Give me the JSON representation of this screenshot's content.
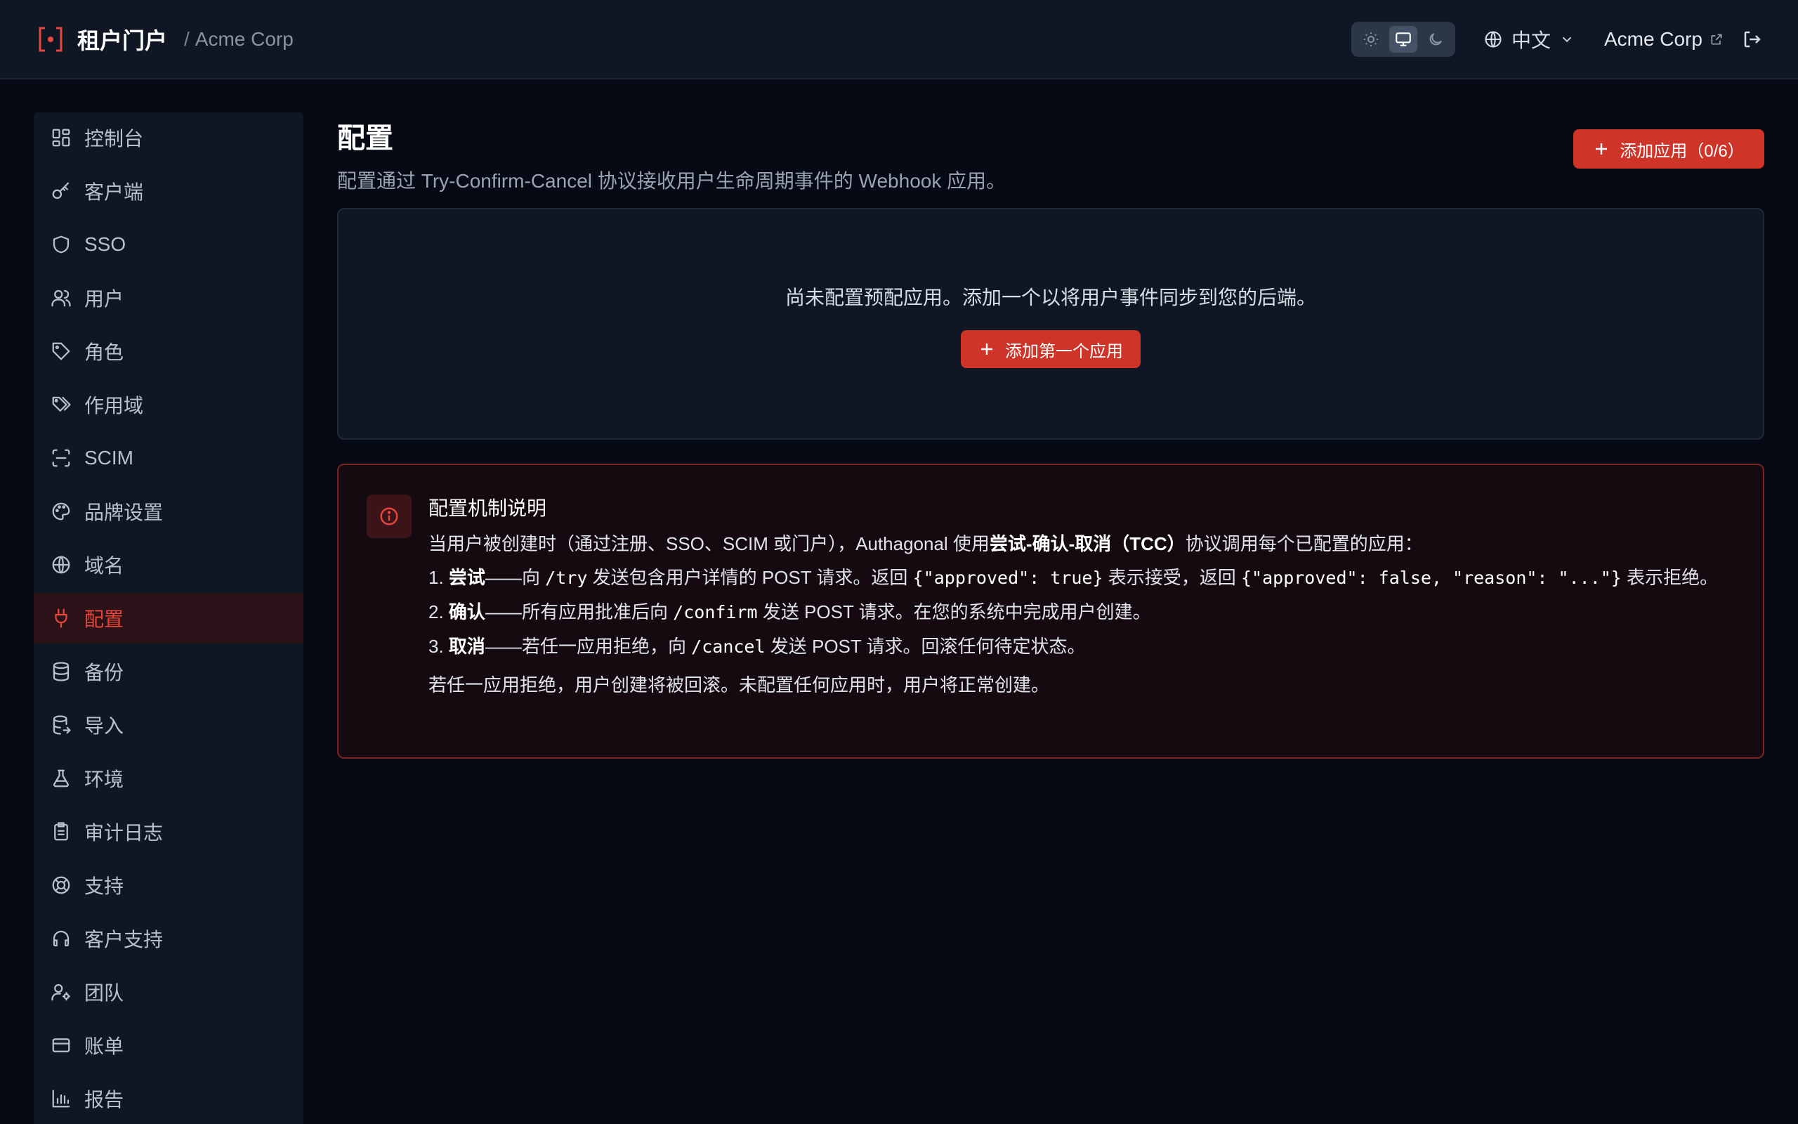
{
  "header": {
    "app_title": "租户门户",
    "separator": "/",
    "org_crumb": "Acme Corp",
    "language": "中文",
    "org_link": "Acme Corp"
  },
  "sidebar": {
    "items": [
      {
        "label": "控制台",
        "icon": "dashboard-icon"
      },
      {
        "label": "客户端",
        "icon": "key-icon"
      },
      {
        "label": "SSO",
        "icon": "shield-icon"
      },
      {
        "label": "用户",
        "icon": "users-icon"
      },
      {
        "label": "角色",
        "icon": "tag-icon"
      },
      {
        "label": "作用域",
        "icon": "tags-icon"
      },
      {
        "label": "SCIM",
        "icon": "scan-icon"
      },
      {
        "label": "品牌设置",
        "icon": "palette-icon"
      },
      {
        "label": "域名",
        "icon": "globe-icon"
      },
      {
        "label": "配置",
        "icon": "plug-icon",
        "active": true
      },
      {
        "label": "备份",
        "icon": "database-icon"
      },
      {
        "label": "导入",
        "icon": "database-import-icon"
      },
      {
        "label": "环境",
        "icon": "flask-icon"
      },
      {
        "label": "审计日志",
        "icon": "clipboard-icon"
      },
      {
        "label": "支持",
        "icon": "lifebuoy-icon"
      },
      {
        "label": "客户支持",
        "icon": "headset-icon"
      },
      {
        "label": "团队",
        "icon": "user-gear-icon"
      },
      {
        "label": "账单",
        "icon": "credit-card-icon"
      },
      {
        "label": "报告",
        "icon": "bar-chart-icon"
      }
    ]
  },
  "main": {
    "title": "配置",
    "subtitle": "配置通过 Try-Confirm-Cancel 协议接收用户生命周期事件的 Webhook 应用。",
    "add_button": "添加应用（0/6）",
    "empty_text": "尚未配置预配应用。添加一个以将用户事件同步到您的后端。",
    "first_button": "添加第一个应用",
    "info": {
      "title": "配置机制说明",
      "intro_a": "当用户被创建时（通过注册、SSO、SCIM 或门户），Authagonal 使用",
      "intro_bold": "尝试-确认-取消（TCC）",
      "intro_b": "协议调用每个已配置的应用：",
      "step1_num": "1. ",
      "step1_bold": "尝试",
      "step1_a": "——向 ",
      "step1_code1": "/try",
      "step1_b": " 发送包含用户详情的 POST 请求。返回 ",
      "step1_code2": "{\"approved\": true}",
      "step1_c": " 表示接受，返回 ",
      "step1_code3": "{\"approved\": false, \"reason\": \"...\"}",
      "step1_d": " 表示拒绝。",
      "step2_num": "2. ",
      "step2_bold": "确认",
      "step2_a": "——所有应用批准后向 ",
      "step2_code": "/confirm",
      "step2_b": " 发送 POST 请求。在您的系统中完成用户创建。",
      "step3_num": "3. ",
      "step3_bold": "取消",
      "step3_a": "——若任一应用拒绝，向 ",
      "step3_code": "/cancel",
      "step3_b": " 发送 POST 请求。回滚任何待定状态。",
      "footer": "若任一应用拒绝，用户创建将被回滚。未配置任何应用时，用户将正常创建。"
    }
  },
  "colors": {
    "accent": "#cf3429",
    "active_text": "#e5483a",
    "background": "#050a14",
    "panel": "#0f1724"
  }
}
